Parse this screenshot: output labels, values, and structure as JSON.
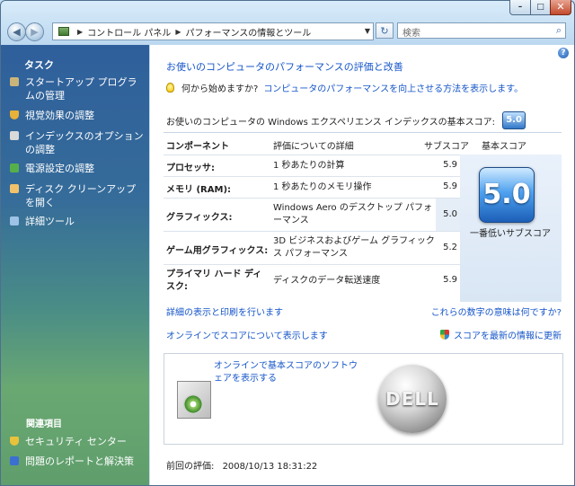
{
  "window": {
    "minimize_glyph": "–",
    "maximize_glyph": "□",
    "close_glyph": "✕"
  },
  "nav": {
    "back_glyph": "◀",
    "forward_glyph": "▶",
    "breadcrumb": [
      "コントロール パネル",
      "パフォーマンスの情報とツール"
    ],
    "breadcrumb_sep": "▶",
    "dropdown_glyph": "▼",
    "refresh_glyph": "↻",
    "search_placeholder": "検索",
    "search_glyph": "⌕"
  },
  "sidebar": {
    "heading": "タスク",
    "items": [
      {
        "label": "スタートアップ プログラムの管理",
        "icon": "startup-icon",
        "color": "#c9b57a"
      },
      {
        "label": "視覚効果の調整",
        "icon": "shield-icon",
        "color": "#e8b13a"
      },
      {
        "label": "インデックスのオプションの調整",
        "icon": "index-icon",
        "color": "#d9d9d9"
      },
      {
        "label": "電源設定の調整",
        "icon": "power-icon",
        "color": "#56b04a"
      },
      {
        "label": "ディスク クリーンアップを開く",
        "icon": "disk-cleanup-icon",
        "color": "#f2c26b"
      },
      {
        "label": "詳細ツール",
        "icon": "tools-icon",
        "color": "#9ec3e6"
      }
    ],
    "related_heading": "関連項目",
    "related": [
      {
        "label": "セキュリティ センター",
        "icon": "security-center-icon",
        "color": "#e9c23c"
      },
      {
        "label": "問題のレポートと解決策",
        "icon": "problem-reports-icon",
        "color": "#3b6fd1"
      }
    ]
  },
  "main": {
    "help_glyph": "?",
    "title_link": "お使いのコンピュータのパフォーマンスの評価と改善",
    "hint_prefix": "何から始めますか?",
    "hint_link": "コンピュータのパフォーマンスを向上させる方法を表示します。",
    "base_score_label": "お使いのコンピュータの Windows エクスペリエンス インデックスの基本スコア:",
    "base_score": "5.0",
    "table": {
      "headers": {
        "component": "コンポーネント",
        "details": "評価についての詳細",
        "subscore": "サブスコア",
        "basescore": "基本スコア"
      },
      "rows": [
        {
          "component": "プロセッサ:",
          "details": "1 秒あたりの計算",
          "subscore": "5.9"
        },
        {
          "component": "メモリ (RAM):",
          "details": "1 秒あたりのメモリ操作",
          "subscore": "5.9"
        },
        {
          "component": "グラフィックス:",
          "details": "Windows Aero のデスクトップ パフォーマンス",
          "subscore": "5.0"
        },
        {
          "component": "ゲーム用グラフィックス:",
          "details": "3D ビジネスおよびゲーム グラフィックス パフォーマンス",
          "subscore": "5.2"
        },
        {
          "component": "プライマリ ハード ディスク:",
          "details": "ディスクのデータ転送速度",
          "subscore": "5.9"
        }
      ],
      "big_score": "5.0",
      "lowest_caption": "一番低いサブスコア"
    },
    "links": {
      "print": "詳細の表示と印刷を行います",
      "meaning": "これらの数字の意味は何ですか?",
      "online": "オンラインでスコアについて表示します",
      "update": "スコアを最新の情報に更新"
    },
    "promo": {
      "text": "オンラインで基本スコアのソフトウェアを表示する",
      "logo_text": "DELL"
    },
    "last_rated_label": "前回の評価:",
    "last_rated_value": "2008/10/13 18:31:22"
  }
}
